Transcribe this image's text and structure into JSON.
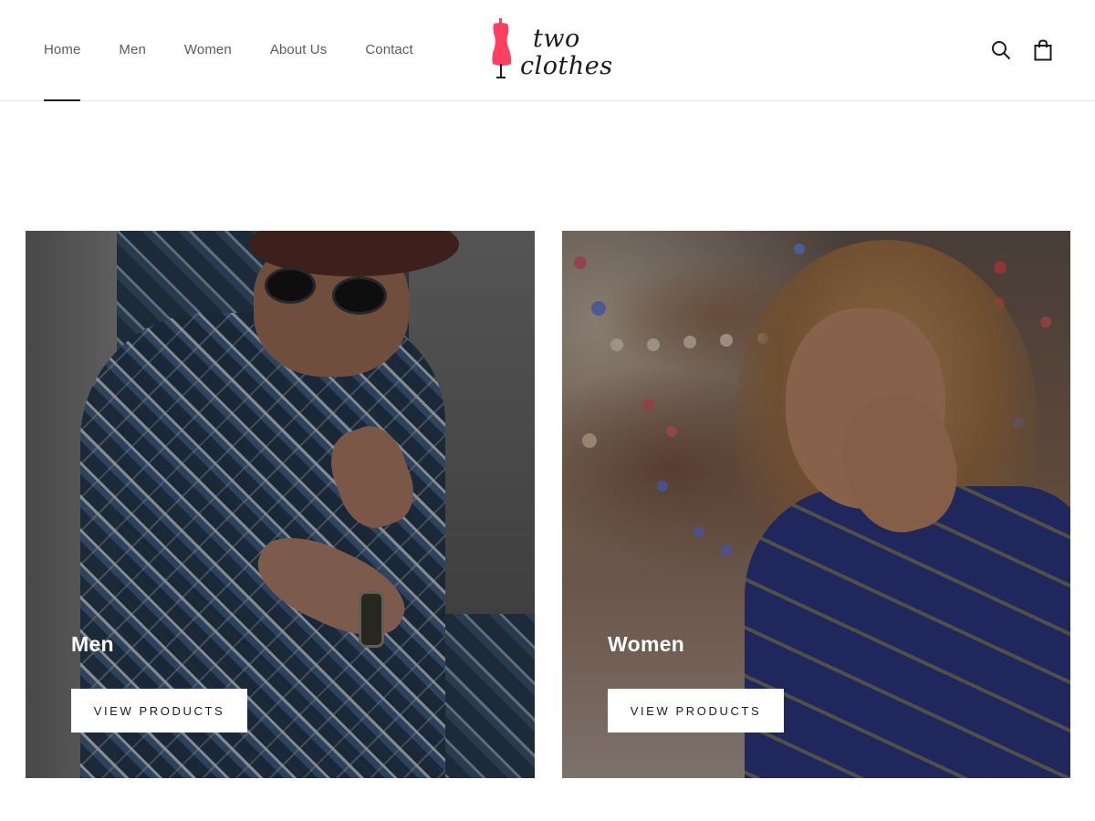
{
  "header": {
    "nav": [
      {
        "label": "Home",
        "active": true
      },
      {
        "label": "Men",
        "active": false
      },
      {
        "label": "Women",
        "active": false
      },
      {
        "label": "About Us",
        "active": false
      },
      {
        "label": "Contact",
        "active": false
      }
    ],
    "logo": {
      "line1": "two",
      "line2": "clothes",
      "mark_color": "#ff3f5f"
    },
    "icons": [
      "search-icon",
      "cart-icon"
    ]
  },
  "collections": [
    {
      "title": "Men",
      "button_label": "VIEW PRODUCTS"
    },
    {
      "title": "Women",
      "button_label": "VIEW PRODUCTS"
    }
  ],
  "colors": {
    "text": "#1c1b1b",
    "nav_text": "#5c5c5c",
    "border": "#e6e6e6",
    "brand": "#ff3f5f"
  }
}
